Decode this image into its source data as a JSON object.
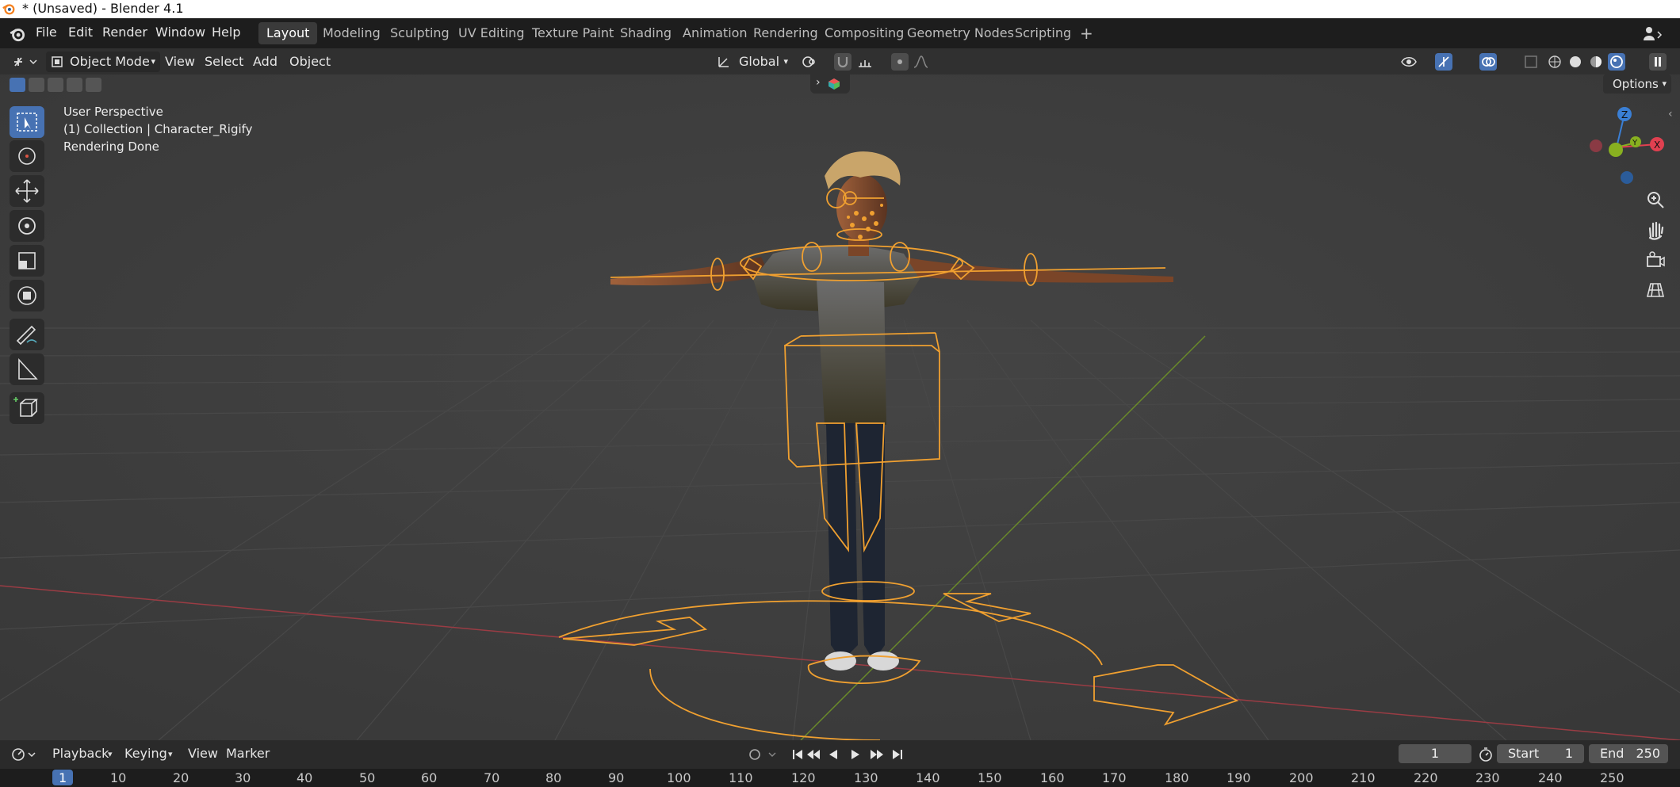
{
  "window": {
    "title": "* (Unsaved) - Blender 4.1"
  },
  "menu": {
    "items": [
      "File",
      "Edit",
      "Render",
      "Window",
      "Help"
    ],
    "workspaces": [
      "Layout",
      "Modeling",
      "Sculpting",
      "UV Editing",
      "Texture Paint",
      "Shading",
      "Animation",
      "Rendering",
      "Compositing",
      "Geometry Nodes",
      "Scripting"
    ],
    "active_workspace": "Layout",
    "add_tab": "+"
  },
  "header": {
    "mode": "Object Mode",
    "view": "View",
    "select": "Select",
    "add": "Add",
    "object": "Object",
    "transform_orientation": "Global",
    "options": "Options"
  },
  "viewport": {
    "perspective": "User Perspective",
    "collection": "(1) Collection | Character_Rigify",
    "status": "Rendering Done",
    "gizmo": {
      "z": "Z",
      "y": "Y",
      "x": "X"
    }
  },
  "timeline": {
    "playback": "Playback",
    "keying": "Keying",
    "view": "View",
    "marker": "Marker",
    "current_frame": "1",
    "start_label": "Start",
    "start_value": "1",
    "end_label": "End",
    "end_value": "250",
    "ruler": [
      "1",
      "10",
      "20",
      "30",
      "40",
      "50",
      "60",
      "70",
      "80",
      "90",
      "100",
      "110",
      "120",
      "130",
      "140",
      "150",
      "160",
      "170",
      "180",
      "190",
      "200",
      "210",
      "220",
      "230",
      "240",
      "250"
    ]
  },
  "colors": {
    "accent": "#4772b3",
    "rig": "#f0a030",
    "x_axis": "#e04050",
    "y_axis": "#88b020",
    "z_axis": "#3a7fd5"
  }
}
